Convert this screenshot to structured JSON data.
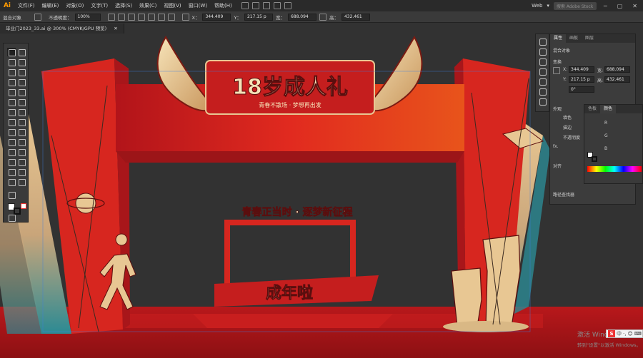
{
  "app": {
    "logo": "Ai"
  },
  "menu": [
    "文件(F)",
    "编辑(E)",
    "对象(O)",
    "文字(T)",
    "选择(S)",
    "效果(C)",
    "视图(V)",
    "窗口(W)",
    "帮助(H)"
  ],
  "workspace": {
    "name": "Web",
    "search_placeholder": "搜索 Adobe Stock"
  },
  "controlbar": {
    "mixed_objects": "混合对象",
    "opacity_label": "不透明度：",
    "opacity_value": "100%",
    "x_label": "X：",
    "x_value": "344.409",
    "y_label": "Y：",
    "y_value": "217.15 p",
    "w_label": "宽：",
    "w_value": "688.094",
    "h_label": "高：",
    "h_value": "432.461"
  },
  "document_tab": {
    "title": "毕业门2023_33.ai @ 300% (CMYK/GPU 预览)"
  },
  "properties": {
    "tabs": [
      "属性",
      "画板",
      "图层"
    ],
    "mixed_objects": "混合对象",
    "transform": "变换",
    "x_label": "X:",
    "x_value": "344.409",
    "y_label": "Y:",
    "y_value": "217.15 p",
    "w_label": "宽:",
    "w_value": "688.094",
    "h_label": "高:",
    "h_value": "432.461",
    "angle_value": "0°",
    "appearance": "外观",
    "fill": "填色",
    "stroke": "描边",
    "opacity": "不透明度",
    "align": "对齐",
    "pathfinder": "路径查找器"
  },
  "color_panel": {
    "tabs": [
      "色板",
      "颜色"
    ],
    "channels": [
      "R",
      "G",
      "B"
    ]
  },
  "artwork": {
    "title_main": "18岁成人礼",
    "title_sub": "青春不散场 · 梦想再出发",
    "banner_text": "青春正当时 · 逐梦新征程",
    "bottom_text": "成年啦"
  },
  "watermark": {
    "line1": "激活 Windows",
    "line2": "转到\"设置\"以激活 Windows。"
  },
  "ime": {
    "label": "中"
  },
  "colors": {
    "arch_red": "#d7261f",
    "gold": "#e8c793",
    "teal": "#2c8a93",
    "canvas": "#3a3a3a"
  }
}
